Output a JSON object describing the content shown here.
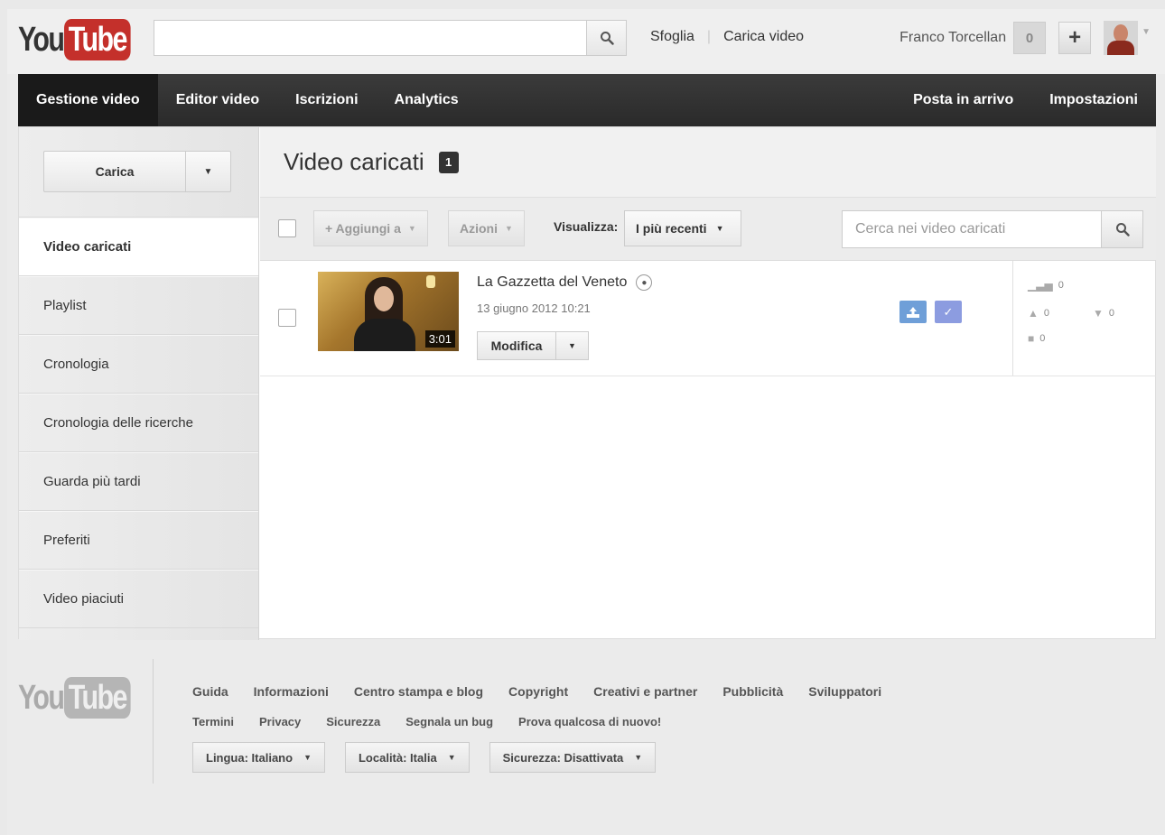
{
  "header": {
    "logo_you": "You",
    "logo_tube": "Tube",
    "search_value": "",
    "browse_label": "Sfoglia",
    "upload_link": "Carica video",
    "user_name": "Franco Torcellan",
    "notification_count": "0",
    "plus_label": "+"
  },
  "nav": {
    "left": [
      "Gestione video",
      "Editor video",
      "Iscrizioni",
      "Analytics"
    ],
    "right": [
      "Posta in arrivo",
      "Impostazioni"
    ]
  },
  "sidebar": {
    "upload_button": "Carica",
    "items": [
      "Video caricati",
      "Playlist",
      "Cronologia",
      "Cronologia delle ricerche",
      "Guarda più tardi",
      "Preferiti",
      "Video piaciuti"
    ]
  },
  "main": {
    "title": "Video caricati",
    "count": "1",
    "toolbar": {
      "add_to": "+ Aggiungi a",
      "actions": "Azioni",
      "view_label": "Visualizza:",
      "sort_value": "I più recenti",
      "search_placeholder": "Cerca nei video caricati"
    },
    "videos": [
      {
        "title": "La Gazzetta del Veneto",
        "date": "13 giugno 2012 10:21",
        "duration": "3:01",
        "edit_label": "Modifica",
        "views": "0",
        "likes": "0",
        "dislikes": "0",
        "comments": "0"
      }
    ]
  },
  "footer": {
    "links_primary": [
      "Guida",
      "Informazioni",
      "Centro stampa e blog",
      "Copyright",
      "Creativi e partner",
      "Pubblicità",
      "Sviluppatori"
    ],
    "links_secondary": [
      "Termini",
      "Privacy",
      "Sicurezza",
      "Segnala un bug",
      "Prova qualcosa di nuovo!"
    ],
    "language": "Lingua: Italiano",
    "location": "Località: Italia",
    "safety": "Sicurezza: Disattivata"
  },
  "colors": {
    "brand_red": "#c4302b",
    "nav_dark": "#2a2a2a",
    "status_blue": "#6f9fd8",
    "status_purple": "#8c9ce0"
  },
  "icons": [
    "search-icon",
    "plus-icon",
    "caret-down-icon",
    "public-icon",
    "upload-status-icon",
    "check-status-icon",
    "views-icon",
    "like-icon",
    "dislike-icon",
    "comment-icon"
  ]
}
